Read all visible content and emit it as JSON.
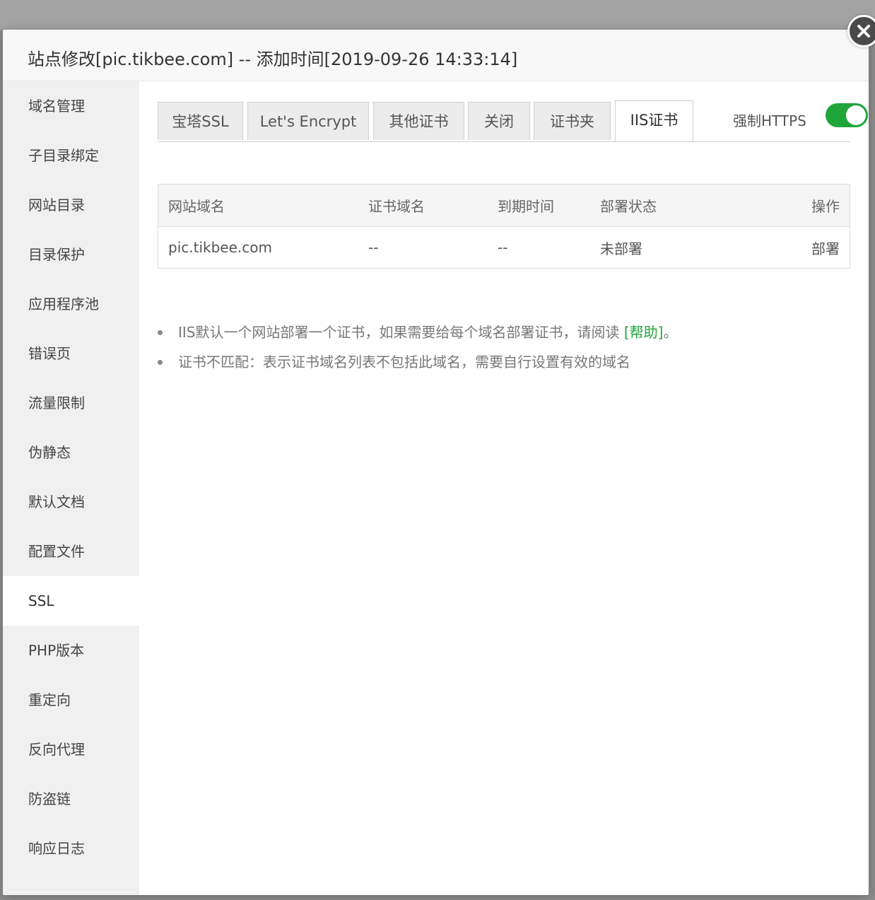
{
  "dialog": {
    "title": "站点修改[pic.tikbee.com] -- 添加时间[2019-09-26 14:33:14]"
  },
  "sidebar": {
    "items": [
      {
        "label": "域名管理"
      },
      {
        "label": "子目录绑定"
      },
      {
        "label": "网站目录"
      },
      {
        "label": "目录保护"
      },
      {
        "label": "应用程序池"
      },
      {
        "label": "错误页"
      },
      {
        "label": "流量限制"
      },
      {
        "label": "伪静态"
      },
      {
        "label": "默认文档"
      },
      {
        "label": "配置文件"
      },
      {
        "label": "SSL",
        "active": true
      },
      {
        "label": "PHP版本"
      },
      {
        "label": "重定向"
      },
      {
        "label": "反向代理"
      },
      {
        "label": "防盗链"
      },
      {
        "label": "响应日志"
      }
    ]
  },
  "tabs": [
    {
      "label": "宝塔SSL"
    },
    {
      "label": "Let's Encrypt"
    },
    {
      "label": "其他证书"
    },
    {
      "label": "关闭"
    },
    {
      "label": "证书夹"
    },
    {
      "label": "IIS证书",
      "active": true
    }
  ],
  "force_https": {
    "label": "强制HTTPS",
    "enabled": true
  },
  "table": {
    "headers": [
      "网站域名",
      "证书域名",
      "到期时间",
      "部署状态",
      "操作"
    ],
    "rows": [
      {
        "site_domain": "pic.tikbee.com",
        "cert_domain": "--",
        "expiry": "--",
        "status": "未部署",
        "action": "部署"
      }
    ]
  },
  "notes": {
    "note1_text": "IIS默认一个网站部署一个证书，如果需要给每个域名部署证书，请阅读 ",
    "note1_link": "[帮助]",
    "note1_suffix": "。",
    "note2_text": "证书不匹配：表示证书域名列表不包括此域名，需要自行设置有效的域名"
  },
  "colors": {
    "accent": "#20a53a",
    "sidebar_bg": "#f0f0f0",
    "header_bg": "#f8f8f8",
    "overlay": "#8c8c8c"
  },
  "icons": {
    "close": "close-icon"
  }
}
